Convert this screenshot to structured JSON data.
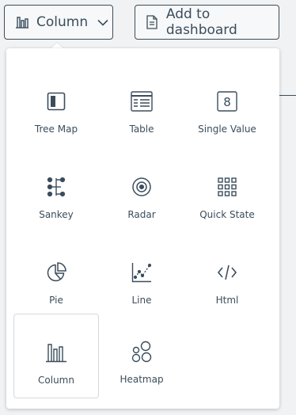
{
  "toolbar": {
    "chart_type_label": "Column",
    "add_to_dashboard_label": "Add to dashboard"
  },
  "chart_types": [
    {
      "label": "Tree Map",
      "icon": "tree-map-icon"
    },
    {
      "label": "Table",
      "icon": "table-icon"
    },
    {
      "label": "Single Value",
      "icon": "single-value-icon",
      "glyph": "8"
    },
    {
      "label": "Sankey",
      "icon": "sankey-icon"
    },
    {
      "label": "Radar",
      "icon": "radar-icon"
    },
    {
      "label": "Quick State",
      "icon": "quick-state-icon"
    },
    {
      "label": "Pie",
      "icon": "pie-icon"
    },
    {
      "label": "Line",
      "icon": "line-icon"
    },
    {
      "label": "Html",
      "icon": "html-icon"
    },
    {
      "label": "Column",
      "icon": "column-icon",
      "selected": true
    },
    {
      "label": "Heatmap",
      "icon": "heatmap-icon"
    }
  ],
  "colors": {
    "text": "#3b4d5c",
    "background": "#f0f2f4",
    "popover": "#ffffff",
    "selected_border": "#d4d9de"
  }
}
